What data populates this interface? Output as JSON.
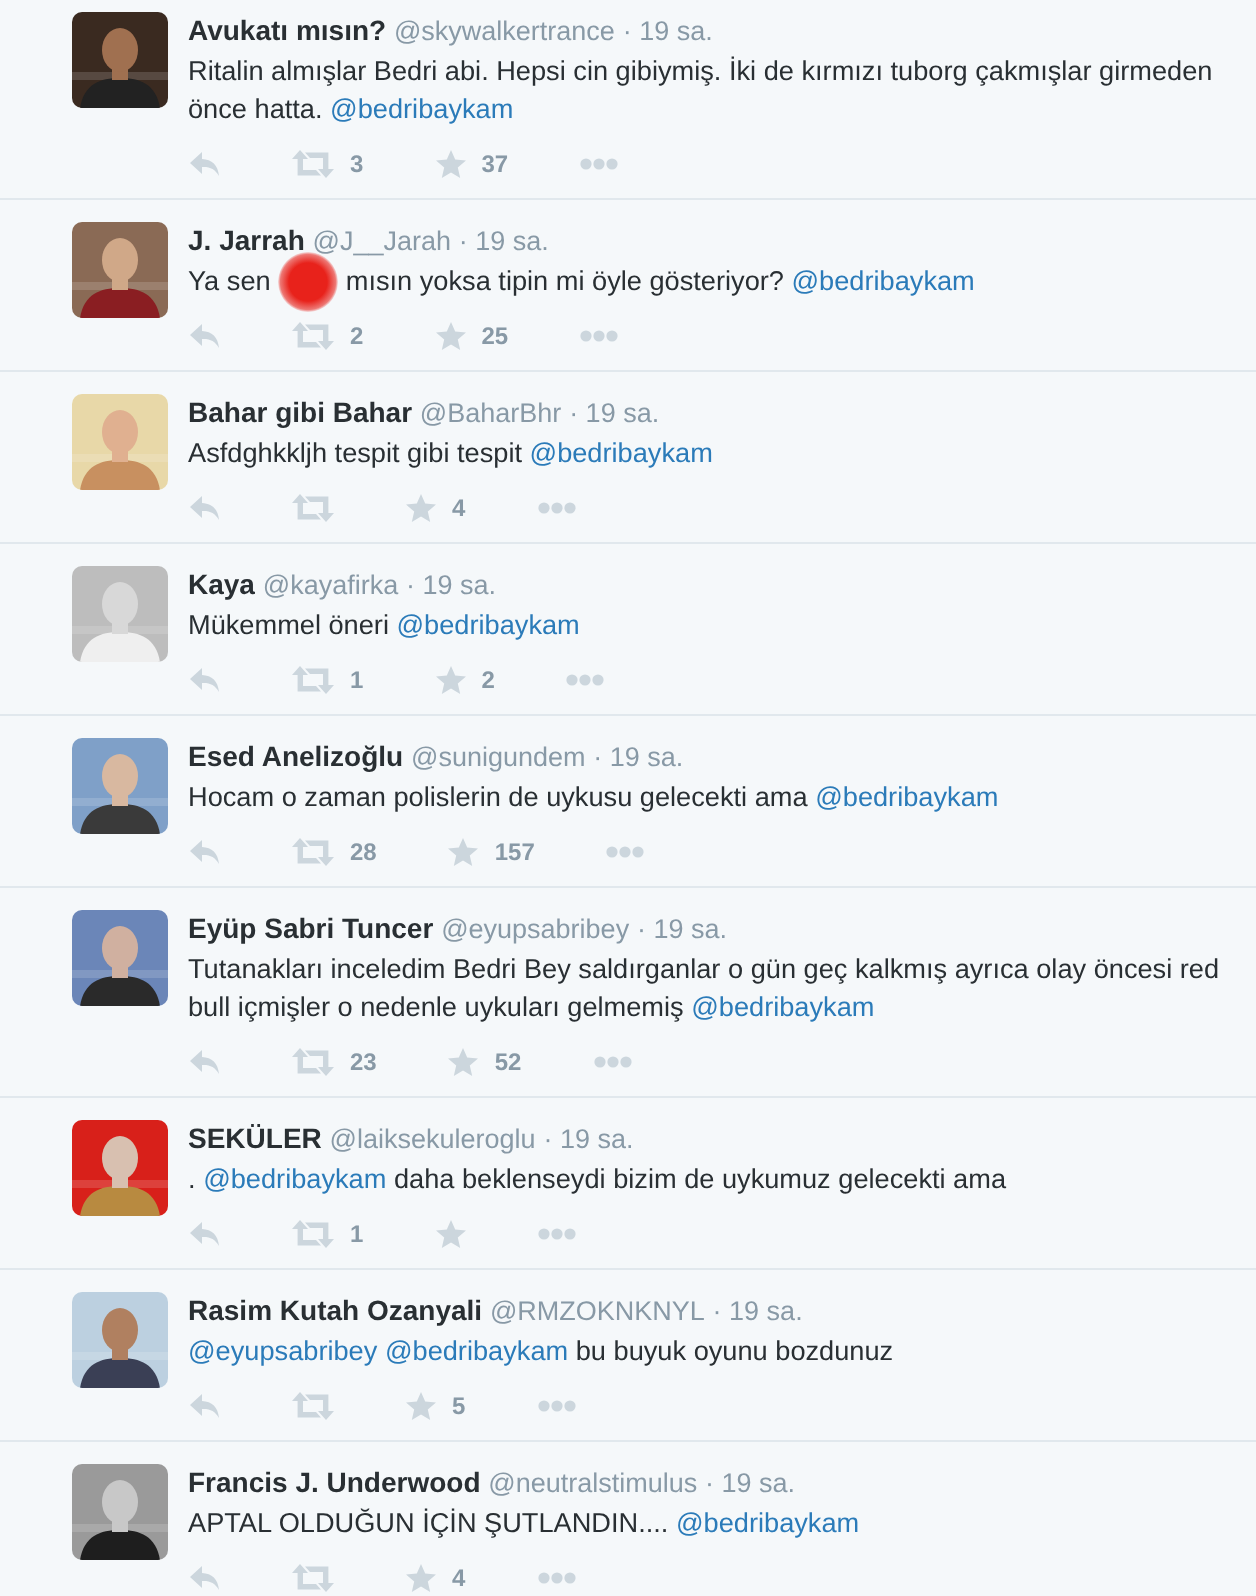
{
  "tweets": [
    {
      "name": "Avukatı mısın?",
      "handle": "@skywalkertrance",
      "time": "· 19 sa.",
      "text": [
        {
          "kind": "plain",
          "text": "Ritalin almışlar Bedri abi. Hepsi cin gibiymiş. İki de kırmızı tuborg çakmışlar girmeden önce hatta. "
        },
        {
          "kind": "mention",
          "text": "@bedribaykam"
        }
      ],
      "retweets": "3",
      "favorites": "37"
    },
    {
      "name": "J. Jarrah",
      "handle": "@J__Jarah",
      "time": "· 19 sa.",
      "touch_indicator": true,
      "text": [
        {
          "kind": "plain",
          "text": "Ya sen"
        },
        {
          "kind": "gap"
        },
        {
          "kind": "plain",
          "text": "mısın yoksa tipin mi öyle gösteriyor? "
        },
        {
          "kind": "mention",
          "text": "@bedribaykam"
        }
      ],
      "retweets": "2",
      "favorites": "25"
    },
    {
      "name": "Bahar gibi Bahar",
      "handle": "@BaharBhr",
      "time": "· 19 sa.",
      "text": [
        {
          "kind": "plain",
          "text": "Asfdghkkljh tespit gibi tespit "
        },
        {
          "kind": "mention",
          "text": "@bedribaykam"
        }
      ],
      "favorites": "4"
    },
    {
      "name": "Kaya",
      "handle": "@kayafirka",
      "time": "· 19 sa.",
      "text": [
        {
          "kind": "plain",
          "text": "Mükemmel öneri "
        },
        {
          "kind": "mention",
          "text": "@bedribaykam"
        }
      ],
      "retweets": "1",
      "favorites": "2"
    },
    {
      "name": "Esed Anelizoğlu",
      "handle": "@sunigundem",
      "time": "· 19 sa.",
      "text": [
        {
          "kind": "plain",
          "text": "Hocam o zaman polislerin de uykusu gelecekti ama "
        },
        {
          "kind": "mention",
          "text": "@bedribaykam"
        }
      ],
      "retweets": "28",
      "favorites": "157"
    },
    {
      "name": "Eyüp Sabri Tuncer",
      "handle": "@eyupsabribey",
      "time": "· 19 sa.",
      "text": [
        {
          "kind": "plain",
          "text": "Tutanakları inceledim Bedri Bey saldırganlar o gün geç kalkmış ayrıca olay öncesi red bull içmişler o nedenle uykuları gelmemiş "
        },
        {
          "kind": "mention",
          "text": "@bedribaykam"
        }
      ],
      "retweets": "23",
      "favorites": "52"
    },
    {
      "name": "SEKÜLER",
      "handle": "@laiksekuleroglu",
      "time": "· 19 sa.",
      "text": [
        {
          "kind": "plain",
          "text": ". "
        },
        {
          "kind": "mention",
          "text": "@bedribaykam"
        },
        {
          "kind": "plain",
          "text": " daha beklenseydi bizim de uykumuz gelecekti ama"
        }
      ],
      "retweets": "1"
    },
    {
      "name": "Rasim Kutah Ozanyali",
      "handle": "@RMZOKNKNYL",
      "time": "· 19 sa.",
      "text": [
        {
          "kind": "mention",
          "text": "@eyupsabribey"
        },
        {
          "kind": "mention",
          "text": "@bedribaykam"
        },
        {
          "kind": "plain",
          "text": " bu buyuk oyunu bozdunuz"
        }
      ],
      "favorites": "5"
    },
    {
      "name": "Francis J. Underwood",
      "handle": "@neutralstimulus",
      "time": "· 19 sa.",
      "text": [
        {
          "kind": "plain",
          "text": "APTAL OLDUĞUN İÇİN ŞUTLANDIN.... "
        },
        {
          "kind": "mention",
          "text": "@bedribaykam"
        }
      ],
      "favorites": "4"
    }
  ]
}
